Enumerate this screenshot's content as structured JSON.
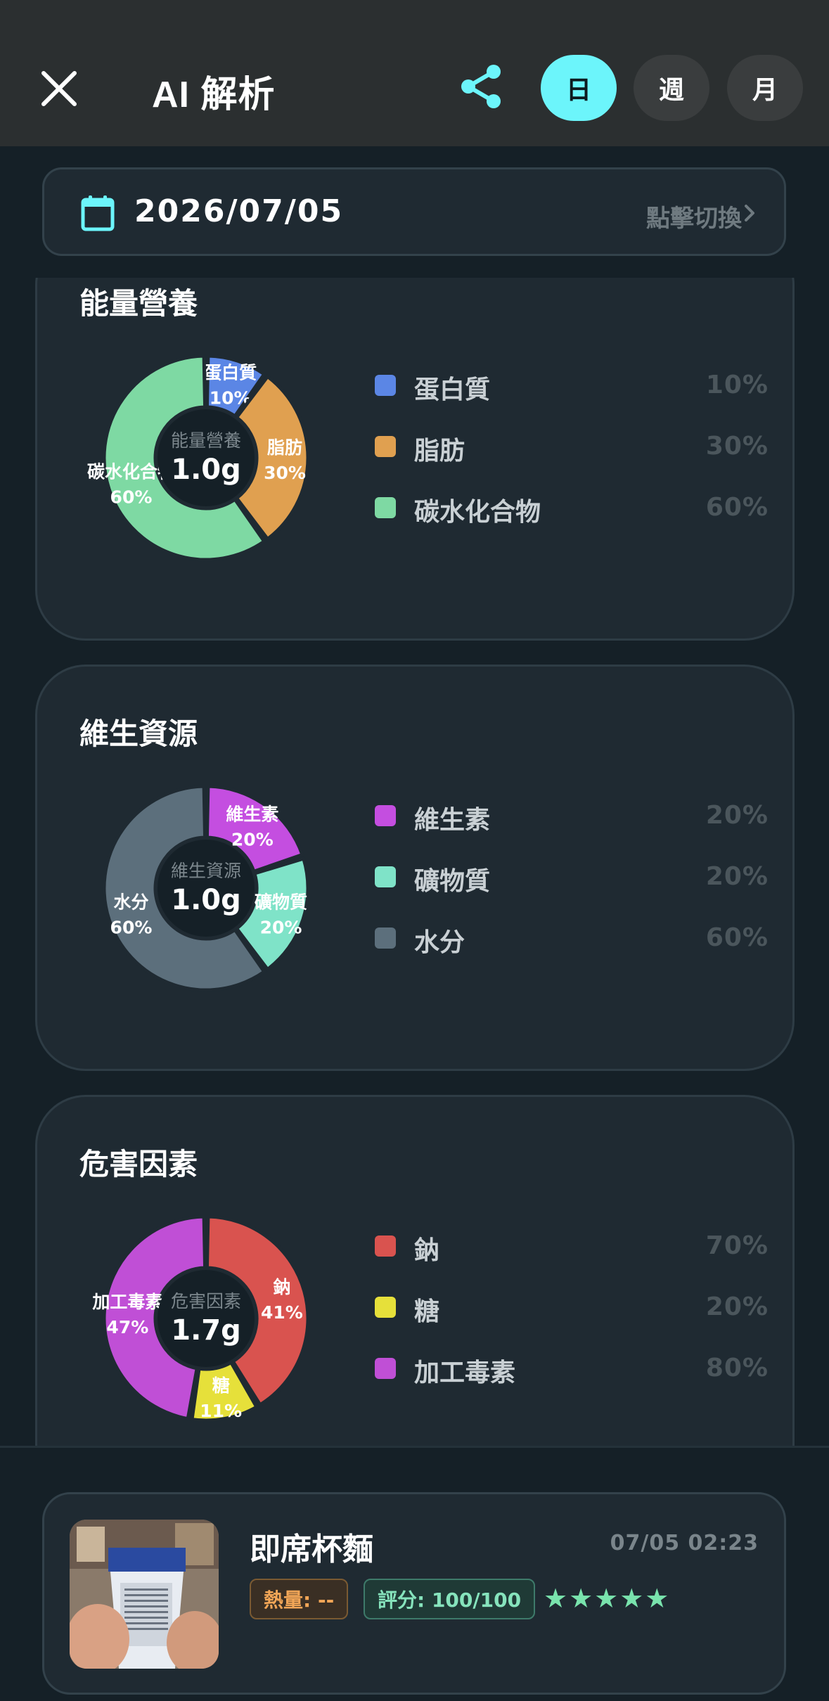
{
  "header": {
    "title": "AI 解析",
    "periods": [
      {
        "label": "日",
        "active": true
      },
      {
        "label": "週",
        "active": false
      },
      {
        "label": "月",
        "active": false
      }
    ],
    "icons": {
      "close": "close-icon",
      "share": "share-icon"
    },
    "accent": "#6cf5fb"
  },
  "date_bar": {
    "date": "2026/07/05",
    "switch_label": "點擊切換",
    "icons": {
      "calendar": "calendar-icon",
      "chevron": "chevron-right-icon"
    }
  },
  "cards": [
    {
      "title": "能量營養",
      "center_label": "能量營養",
      "center_value": "1.0g",
      "segments": [
        {
          "name": "蛋白質",
          "percent": 10,
          "donut_percent": "10%",
          "legend_percent": "10%",
          "color": "#5b86e5"
        },
        {
          "name": "脂肪",
          "percent": 30,
          "donut_percent": "30%",
          "legend_percent": "30%",
          "color": "#e0a050"
        },
        {
          "name": "碳水化合物",
          "percent": 60,
          "donut_percent": "60%",
          "legend_percent": "60%",
          "color": "#7ed9a3"
        }
      ]
    },
    {
      "title": "維生資源",
      "center_label": "維生資源",
      "center_value": "1.0g",
      "segments": [
        {
          "name": "維生素",
          "percent": 20,
          "donut_percent": "20%",
          "legend_percent": "20%",
          "color": "#c44ee0"
        },
        {
          "name": "礦物質",
          "percent": 20,
          "donut_percent": "20%",
          "legend_percent": "20%",
          "color": "#7fe3c8"
        },
        {
          "name": "水分",
          "percent": 60,
          "donut_percent": "60%",
          "legend_percent": "60%",
          "color": "#5c6f7c"
        }
      ]
    },
    {
      "title": "危害因素",
      "center_label": "危害因素",
      "center_value": "1.7g",
      "segments": [
        {
          "name": "鈉",
          "percent": 41,
          "donut_percent": "41%",
          "legend_percent": "70%",
          "color": "#d9534f"
        },
        {
          "name": "糖",
          "percent": 11,
          "donut_percent": "11%",
          "legend_percent": "20%",
          "color": "#e6e03a"
        },
        {
          "name": "加工毒素",
          "percent": 47,
          "donut_percent": "47%",
          "legend_percent": "80%",
          "color": "#c04fd6"
        }
      ]
    }
  ],
  "food": {
    "name": "即席杯麵",
    "time": "07/05 02:23",
    "calorie_badge": "熱量: --",
    "score_badge": "評分: 100/100",
    "stars": 5,
    "stars_text": "★★★★★"
  }
}
